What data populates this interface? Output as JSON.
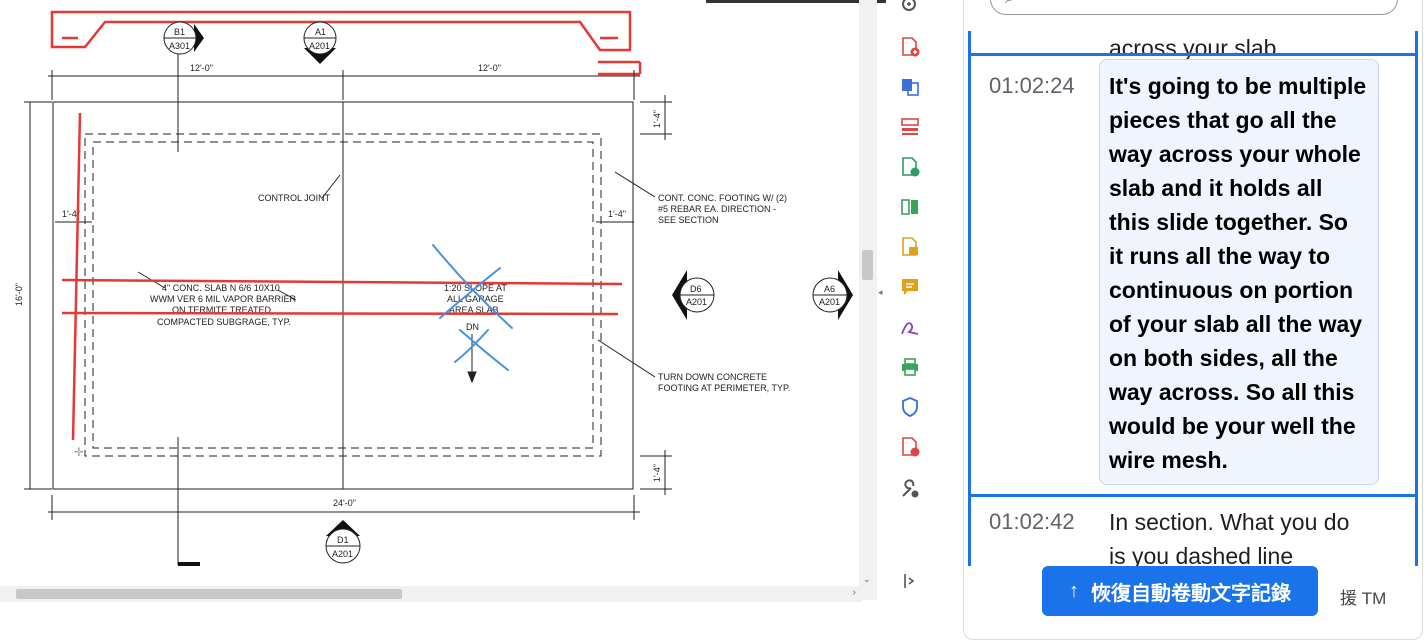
{
  "drawing": {
    "dims": {
      "top_left": "12'-0\"",
      "top_right": "12'-0\"",
      "bottom": "24'-0\"",
      "left": "16'-0\"",
      "right_top": "1'-4\"",
      "right_bottom": "1'-4\"",
      "side_left": "1'-4\"",
      "side_right": "1'-4\""
    },
    "markers": [
      {
        "id": "B1",
        "sheet": "A301"
      },
      {
        "id": "A1",
        "sheet": "A201"
      },
      {
        "id": "D6",
        "sheet": "A201"
      },
      {
        "id": "A6",
        "sheet": "A201"
      },
      {
        "id": "D1",
        "sheet": "A201"
      }
    ],
    "notes": {
      "control_joint": "CONTROL JOINT",
      "footing_1": "CONT. CONC. FOOTING W/ (2)",
      "footing_2": "#5 REBAR EA. DIRECTION -",
      "footing_3": "SEE SECTION",
      "slab_1": "4\" CONC. SLAB N 6/6 10X10",
      "slab_2": "WWM VER 6 MIL VAPOR BARRIER",
      "slab_3": "ON TERMITE TREATED",
      "slab_4": "COMPACTED SUBGRAGE, TYP.",
      "slope_1": "1:20 SLOPE AT",
      "slope_2": "ALL GARAGE",
      "slope_3": "AREA SLAB",
      "slope_dn": "DN",
      "turn_1": "TURN DOWN CONCRETE",
      "turn_2": "FOOTING AT PERIMETER, TYP."
    }
  },
  "toolbar": {
    "tools": [
      {
        "icon": "zoom-icon",
        "color": "#555555"
      },
      {
        "icon": "create-pdf-icon",
        "color": "#e04545"
      },
      {
        "icon": "combine-files-icon",
        "color": "#3b6fd9"
      },
      {
        "icon": "organize-pages-icon",
        "color": "#e04545"
      },
      {
        "icon": "export-pdf-icon",
        "color": "#2e9c6a"
      },
      {
        "icon": "scan-icon",
        "color": "#3aa35a"
      },
      {
        "icon": "edit-pdf-icon",
        "color": "#e0a21a"
      },
      {
        "icon": "comment-icon",
        "color": "#e0a21a"
      },
      {
        "icon": "fill-sign-icon",
        "color": "#8a3fc4"
      },
      {
        "icon": "print-production-icon",
        "color": "#3aa35a"
      },
      {
        "icon": "protect-icon",
        "color": "#3b6fd9"
      },
      {
        "icon": "pdf-info-icon",
        "color": "#e04545"
      },
      {
        "icon": "more-tools-icon",
        "color": "#555555"
      },
      {
        "icon": "collapse-panel-icon",
        "color": "#555555"
      }
    ]
  },
  "transcript": {
    "entries": [
      {
        "time": "",
        "text": "across your slab."
      },
      {
        "time": "01:02:24",
        "text": "It's going to be multiple pieces that go all the way across your whole slab and it holds all this slide together. So it runs all the way to continuous on portion of your slab all the way on both sides, all the way across. So all this would be your well the wire mesh."
      },
      {
        "time": "01:02:42",
        "text": "In section. What you do is you dashed line"
      }
    ],
    "resume_button": "恢復自動卷動文字記錄",
    "resume_arrow": "↑",
    "footer_fragment": "援 TM"
  },
  "colors": {
    "accent": "#1a73e8",
    "markup_red": "#e53935",
    "markup_blue": "#4a90e2"
  }
}
